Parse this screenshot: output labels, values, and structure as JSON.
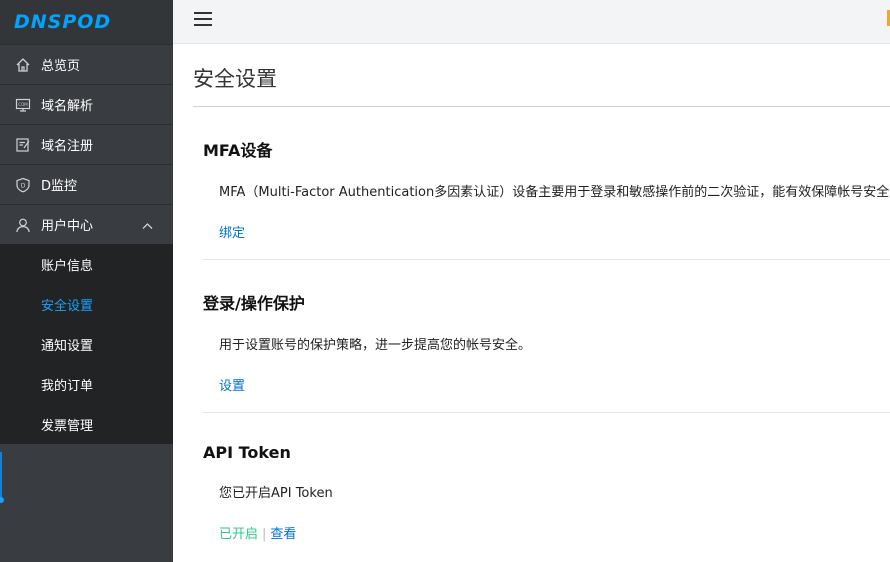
{
  "brand": {
    "logo_text": "DNSPOD"
  },
  "sidebar": {
    "items": [
      {
        "label": "总览页",
        "icon": "home-icon"
      },
      {
        "label": "域名解析",
        "icon": "dns-icon"
      },
      {
        "label": "域名注册",
        "icon": "register-icon"
      },
      {
        "label": "D监控",
        "icon": "shield-icon"
      },
      {
        "label": "用户中心",
        "icon": "user-icon",
        "expanded": true
      }
    ],
    "submenu": [
      {
        "label": "账户信息",
        "active": false
      },
      {
        "label": "安全设置",
        "active": true
      },
      {
        "label": "通知设置",
        "active": false
      },
      {
        "label": "我的订单",
        "active": false
      },
      {
        "label": "发票管理",
        "active": false
      }
    ]
  },
  "page": {
    "title": "安全设置"
  },
  "sections": {
    "mfa": {
      "title": "MFA设备",
      "description": "MFA（Multi-Factor Authentication多因素认证）设备主要用于登录和敏感操作前的二次验证，能有效保障帐号安全",
      "action": "绑定"
    },
    "protect": {
      "title": "登录/操作保护",
      "description": "用于设置账号的保护策略，进一步提高您的帐号安全。",
      "action": "设置"
    },
    "api": {
      "title": "API Token",
      "description": "您已开启API Token",
      "status": "已开启",
      "separator": "|",
      "action": "查看"
    }
  },
  "colors": {
    "sidebar_bg": "#393c41",
    "submenu_bg": "#222325",
    "accent": "#1aa1ff",
    "link": "#0071ce",
    "enabled": "#29cc85"
  }
}
